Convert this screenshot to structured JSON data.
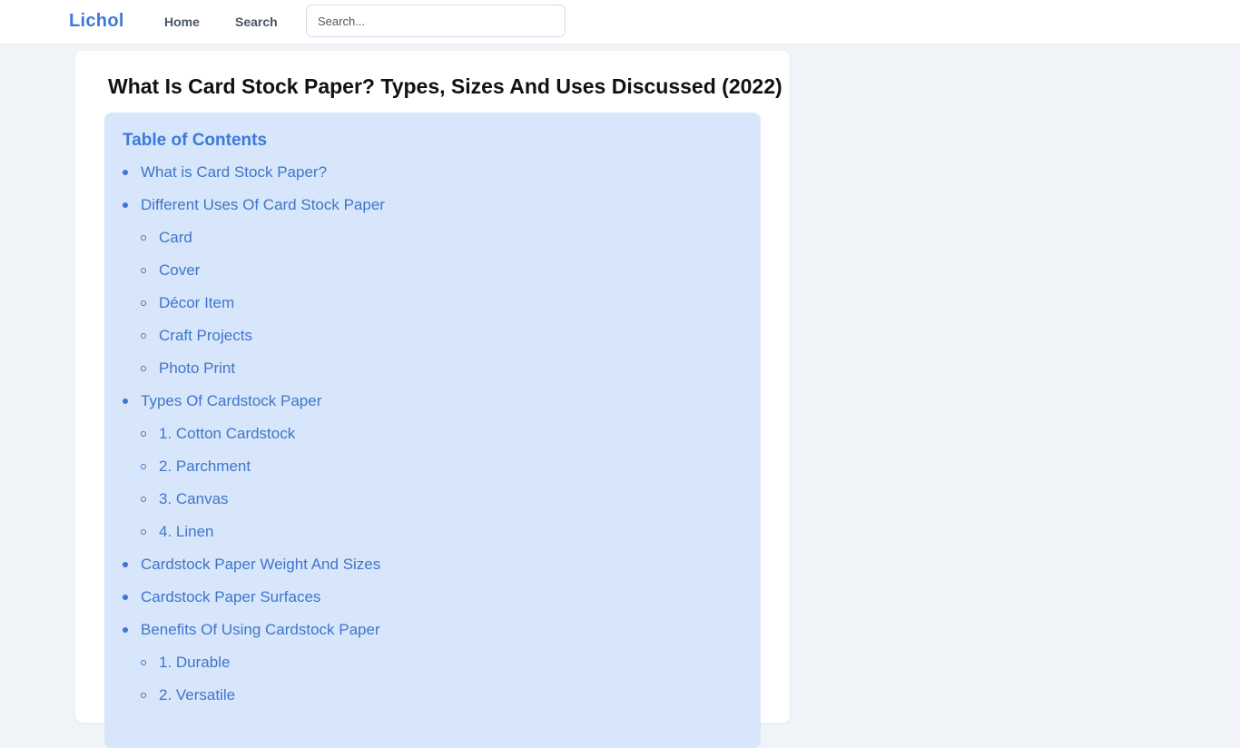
{
  "header": {
    "brand": "Lichol",
    "nav": [
      {
        "label": "Home"
      },
      {
        "label": "Search"
      }
    ],
    "search": {
      "placeholder": "Search...",
      "value": ""
    }
  },
  "article": {
    "title": "What Is Card Stock Paper? Types, Sizes And Uses Discussed (2022)"
  },
  "toc": {
    "heading": "Table of Contents",
    "items": [
      {
        "label": "What is Card Stock Paper?",
        "level": 1
      },
      {
        "label": "Different Uses Of Card Stock Paper",
        "level": 1
      },
      {
        "label": "Card",
        "level": 2
      },
      {
        "label": "Cover",
        "level": 2
      },
      {
        "label": "Décor Item",
        "level": 2
      },
      {
        "label": "Craft Projects",
        "level": 2
      },
      {
        "label": "Photo Print",
        "level": 2
      },
      {
        "label": "Types Of Cardstock Paper",
        "level": 1
      },
      {
        "label": "1. Cotton Cardstock",
        "level": 2
      },
      {
        "label": "2. Parchment",
        "level": 2
      },
      {
        "label": "3. Canvas",
        "level": 2
      },
      {
        "label": "4. Linen",
        "level": 2
      },
      {
        "label": "Cardstock Paper Weight And Sizes",
        "level": 1
      },
      {
        "label": "Cardstock Paper Surfaces",
        "level": 1
      },
      {
        "label": "Benefits Of Using Cardstock Paper",
        "level": 1
      },
      {
        "label": "1. Durable",
        "level": 2
      },
      {
        "label": "2. Versatile",
        "level": 2
      }
    ]
  },
  "colors": {
    "accent": "#3b7ad9",
    "toc_background": "#d8e6fb",
    "page_background": "#f0f3f8"
  }
}
